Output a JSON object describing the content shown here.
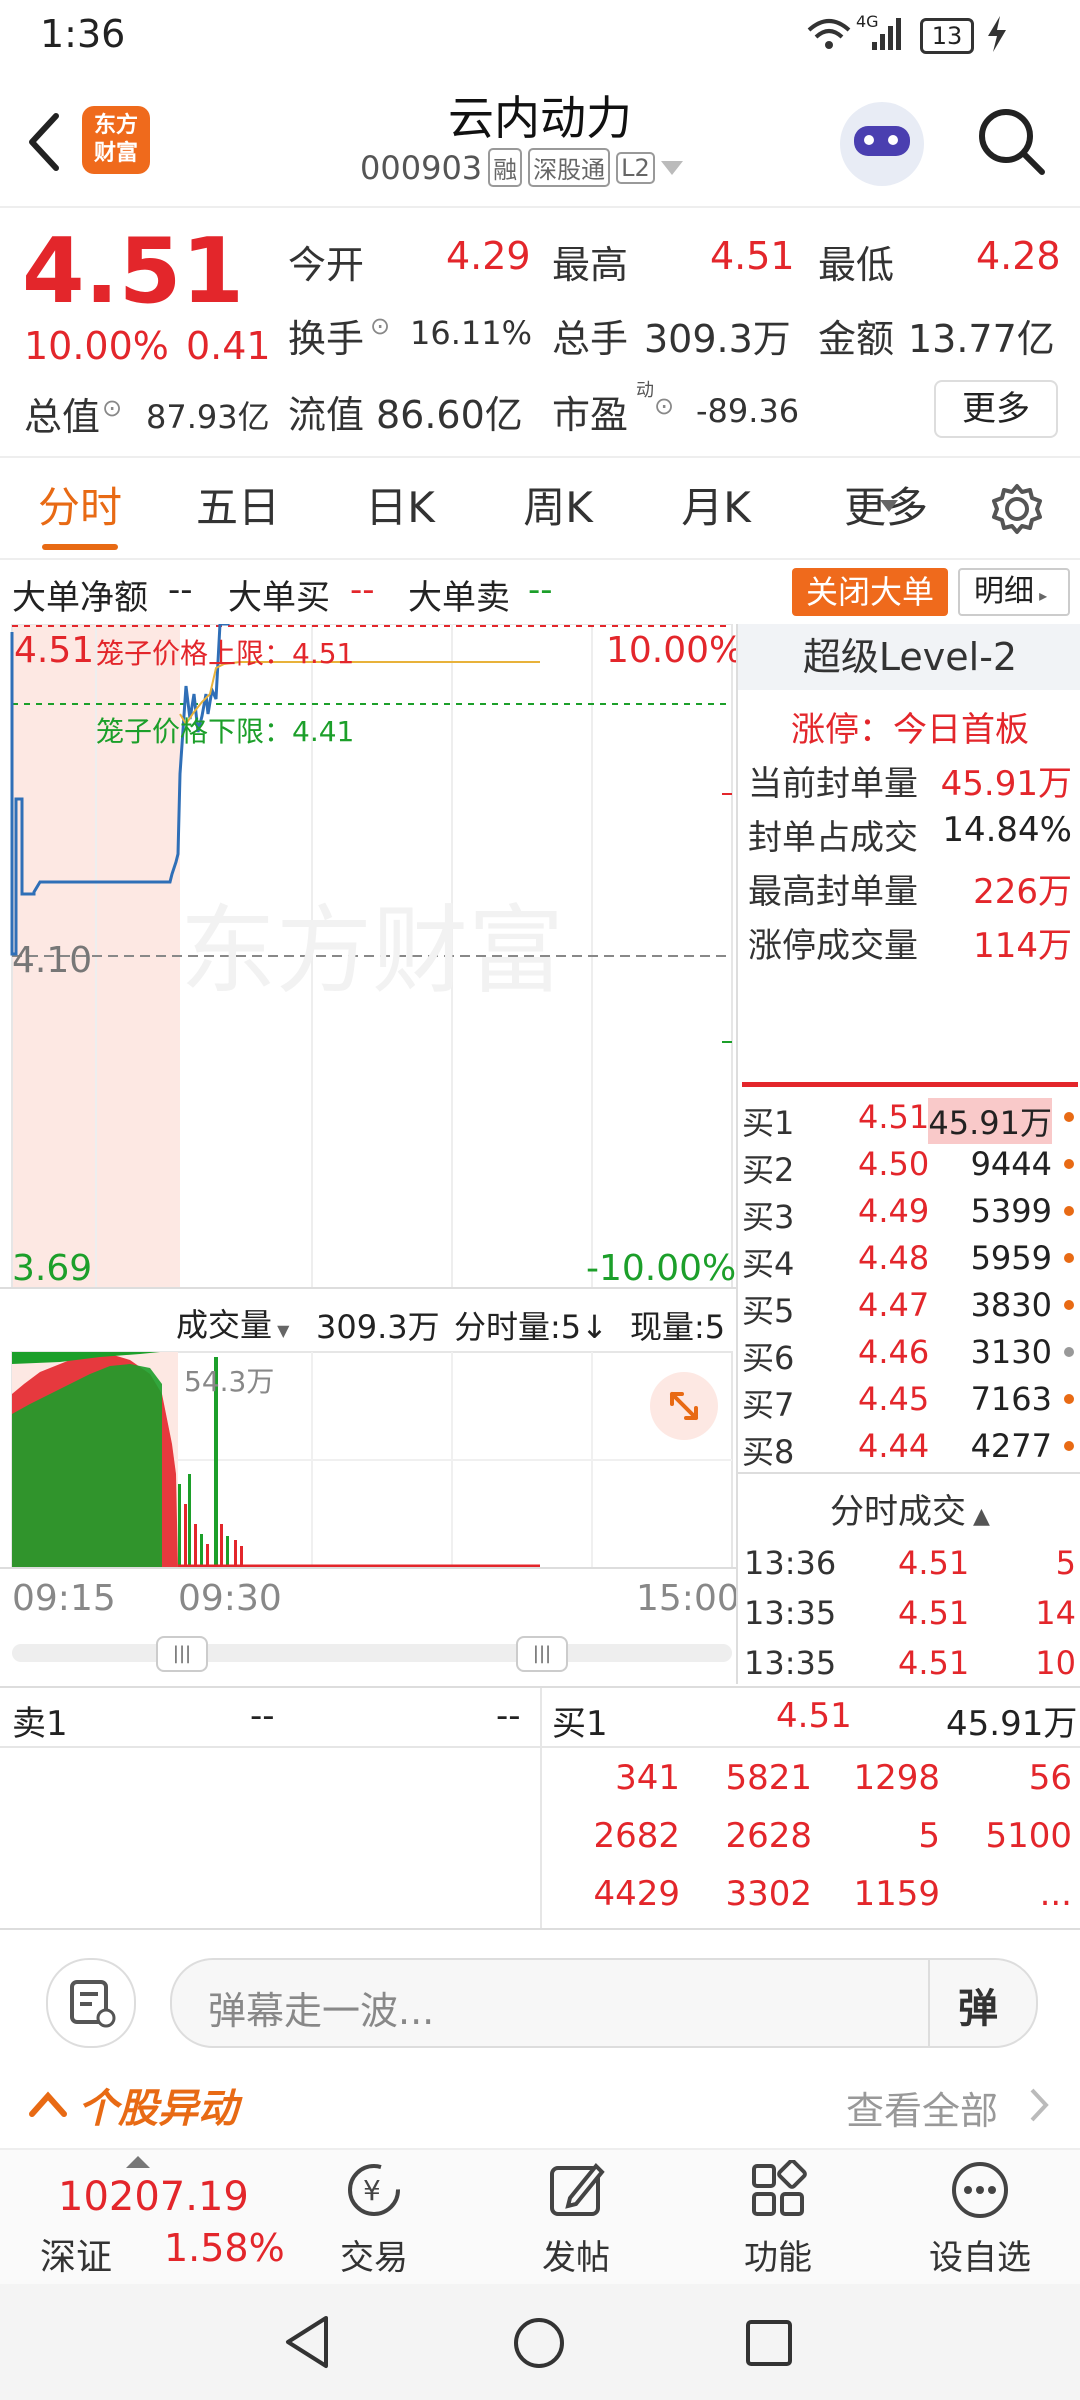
{
  "status_bar": {
    "time": "1:36",
    "signal": "4G",
    "battery": "13"
  },
  "header": {
    "logo_line1": "东方",
    "logo_line2": "财富",
    "title": "云内动力",
    "code": "000903",
    "tags": [
      "融",
      "深股通",
      "L2"
    ]
  },
  "quote": {
    "price": "4.51",
    "change_pct": "10.00%",
    "change_amt": "0.41",
    "open_label": "今开",
    "open": "4.29",
    "high_label": "最高",
    "high": "4.51",
    "low_label": "最低",
    "low": "4.28",
    "turnover_label": "换手",
    "turnover": "16.11%",
    "volume_label": "总手",
    "volume": "309.3万",
    "amount_label": "金额",
    "amount": "13.77亿",
    "mktcap_label": "总值",
    "mktcap": "87.93亿",
    "float_label": "流值",
    "float": "86.60亿",
    "pe_label": "市盈",
    "pe_sup": "动",
    "pe": "-89.36",
    "more_button": "更多"
  },
  "tabs": [
    "分时",
    "五日",
    "日K",
    "周K",
    "月K",
    "更多"
  ],
  "bigorder": {
    "net_label": "大单净额",
    "net_value": "--",
    "buy_label": "大单买",
    "buy_value": "--",
    "sell_label": "大单卖",
    "sell_value": "--",
    "close_button": "关闭大单",
    "detail_button": "明细"
  },
  "chart": {
    "y_top": "4.51",
    "y_mid": "4.10",
    "y_bottom": "3.69",
    "pct_top": "10.00%",
    "pct_bottom": "-10.00%",
    "upper_label": "笼子价格上限：4.51",
    "lower_label": "笼子价格下限：4.41",
    "watermark": "东方财富",
    "vol_selector": "成交量",
    "vol_total": "309.3万",
    "fenshi_label": "分时量:5↓",
    "now_label": "现量:5",
    "vol_max": "54.3万",
    "time_start": "09:15",
    "time_open": "09:30",
    "time_end": "15:00"
  },
  "level2": {
    "title": "超级Level-2",
    "limit_line": "涨停：今日首板",
    "rows": [
      {
        "label": "当前封单量",
        "value": "45.91万"
      },
      {
        "label": "封单占成交",
        "value": "14.84%"
      },
      {
        "label": "最高封单量",
        "value": "226万"
      },
      {
        "label": "涨停成交量",
        "value": "114万"
      }
    ],
    "bids": [
      {
        "label": "买1",
        "price": "4.51",
        "vol": "45.91万"
      },
      {
        "label": "买2",
        "price": "4.50",
        "vol": "9444"
      },
      {
        "label": "买3",
        "price": "4.49",
        "vol": "5399"
      },
      {
        "label": "买4",
        "price": "4.48",
        "vol": "5959"
      },
      {
        "label": "买5",
        "price": "4.47",
        "vol": "3830"
      },
      {
        "label": "买6",
        "price": "4.46",
        "vol": "3130"
      },
      {
        "label": "买7",
        "price": "4.45",
        "vol": "7163"
      },
      {
        "label": "买8",
        "price": "4.44",
        "vol": "4277"
      }
    ],
    "ticks_title": "分时成交",
    "ticks": [
      {
        "time": "13:36",
        "price": "4.51",
        "vol": "5"
      },
      {
        "time": "13:35",
        "price": "4.51",
        "vol": "14"
      },
      {
        "time": "13:35",
        "price": "4.51",
        "vol": "10"
      }
    ]
  },
  "orderbook": {
    "sell_label": "卖1",
    "sell_price": "--",
    "sell_vol": "--",
    "buy_label": "买1",
    "buy_price": "4.51",
    "buy_vol": "45.91万",
    "queue": [
      [
        "341",
        "5821",
        "1298",
        "56"
      ],
      [
        "2682",
        "2628",
        "5",
        "5100"
      ],
      [
        "4429",
        "3302",
        "1159",
        "..."
      ]
    ]
  },
  "danmu": {
    "placeholder": "弹幕走一波...",
    "button": "弹"
  },
  "yidong": {
    "title": "个股异动",
    "view_all": "查看全部"
  },
  "bottom_nav": {
    "index_value": "10207.19",
    "index_name": "深证",
    "index_change": "1.58%",
    "items": [
      "交易",
      "发帖",
      "功能",
      "设自选"
    ]
  },
  "colors": {
    "up": "#e3262b",
    "down": "#1c9f2a",
    "accent": "#e86a14",
    "line": "#2f6fb7"
  }
}
